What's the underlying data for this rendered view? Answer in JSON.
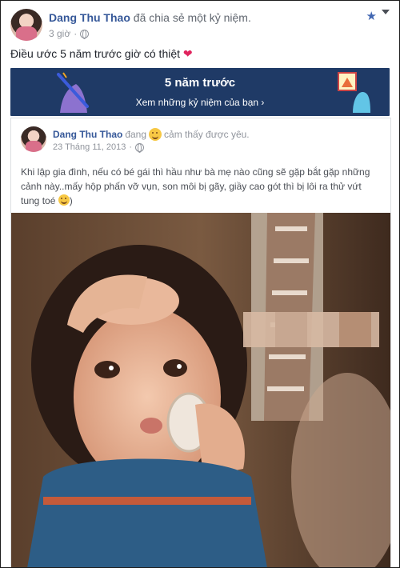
{
  "post": {
    "author": "Dang Thu Thao",
    "action": "đã chia sẻ một kỷ niệm.",
    "time": "3 giờ",
    "text": "Điều ước 5 năm trước giờ có thiệt",
    "heart": "❤"
  },
  "banner": {
    "title": "5 năm trước",
    "link": "Xem những kỷ niệm của bạn ›"
  },
  "memory": {
    "author": "Dang Thu Thao",
    "feeling_prefix": "đang",
    "feeling": "cảm thấy được yêu.",
    "date": "23 Tháng 11, 2013",
    "text": "Khi lập gia đình, nếu có bé gái thì hầu như bà mẹ nào cũng sẽ gặp bắt gặp những cảnh này..mấy hộp phấn vỡ vụn, son môi bị gãy, giầy cao gót thì bị lôi ra thử vứt tung toé"
  },
  "colors": {
    "link_blue": "#365899",
    "banner_bg": "#1f3a66",
    "heart": "#e0245e"
  },
  "icons": [
    "globe-icon",
    "star-icon",
    "chevron-down-icon",
    "heart-icon",
    "smile-icon",
    "feeling-emoji-icon"
  ]
}
